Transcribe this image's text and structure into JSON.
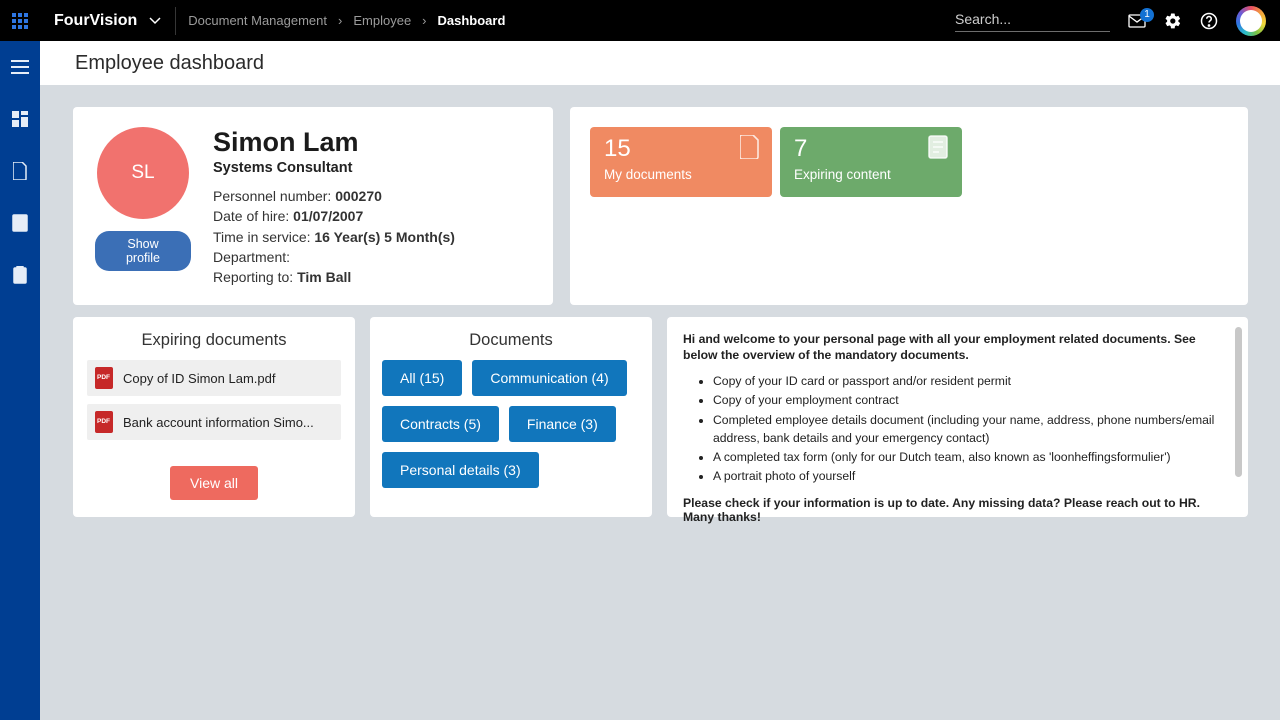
{
  "header": {
    "brand": "FourVision",
    "breadcrumb": [
      "Document Management",
      "Employee",
      "Dashboard"
    ],
    "search_placeholder": "Search...",
    "notification_count": "1"
  },
  "page": {
    "title": "Employee dashboard"
  },
  "profile": {
    "initials": "SL",
    "show_profile_btn": "Show profile",
    "name": "Simon Lam",
    "title": "Systems Consultant",
    "personnel_label": "Personnel number: ",
    "personnel_value": "000270",
    "hire_label": "Date of hire: ",
    "hire_value": "01/07/2007",
    "service_label": "Time in service: ",
    "service_value": "16 Year(s) 5 Month(s)",
    "department_label": "Department:",
    "department_value": "",
    "reporting_label": "Reporting to: ",
    "reporting_value": "Tim Ball"
  },
  "tiles": {
    "my_docs_count": "15",
    "my_docs_label": "My documents",
    "expiring_count": "7",
    "expiring_label": "Expiring content"
  },
  "expiring": {
    "title": "Expiring documents",
    "items": [
      "Copy of ID Simon Lam.pdf",
      "Bank account information Simo..."
    ],
    "view_all": "View all"
  },
  "documents": {
    "title": "Documents",
    "chips": [
      "All (15)",
      "Communication (4)",
      "Contracts (5)",
      "Finance (3)",
      "Personal details (3)"
    ]
  },
  "welcome": {
    "intro": "Hi and welcome to your personal page with all your employment related documents. See below the overview of the mandatory documents.",
    "items": [
      "Copy of your ID card or passport and/or resident permit",
      "Copy of your employment contract",
      "Completed employee details document (including your name, address, phone numbers/email address, bank details and your emergency contact)",
      "A completed tax form (only for our Dutch team, also known as 'loonheffingsformulier')",
      "A portrait photo of yourself"
    ],
    "footer": "Please check if your information is up to date. Any missing data? Please reach out to HR. Many thanks!"
  }
}
